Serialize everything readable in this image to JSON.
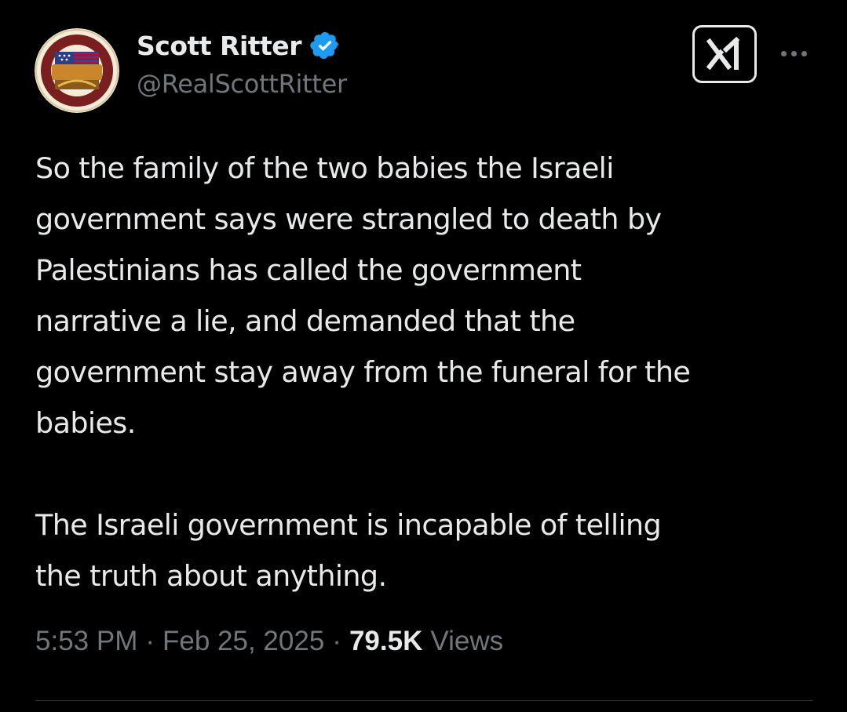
{
  "author": {
    "display_name": "Scott Ritter",
    "handle": "@RealScottRitter",
    "verified": true,
    "avatar_icon": "operation-dawn-seal-avatar"
  },
  "toolbar": {
    "grok_icon": "grok-icon",
    "more_icon": "more-horizontal-icon"
  },
  "tweet": {
    "paragraph1_lines": [
      "So the family of the two babies the Israeli",
      "government says were strangled to death by",
      "Palestinians has called the government",
      "narrative a lie, and demanded that the",
      "government stay away from the funeral for the",
      "babies."
    ],
    "paragraph2_lines": [
      "The Israeli government is incapable of telling",
      "the truth about anything."
    ]
  },
  "meta": {
    "time": "5:53 PM",
    "date": "Feb 25, 2025",
    "separator": "·",
    "views_count": "79.5K",
    "views_label": "Views"
  },
  "colors": {
    "background": "#000000",
    "text_primary": "#e7e9ea",
    "text_secondary": "#71767b",
    "verified_blue": "#1d9bf0",
    "divider": "#2f3336"
  }
}
